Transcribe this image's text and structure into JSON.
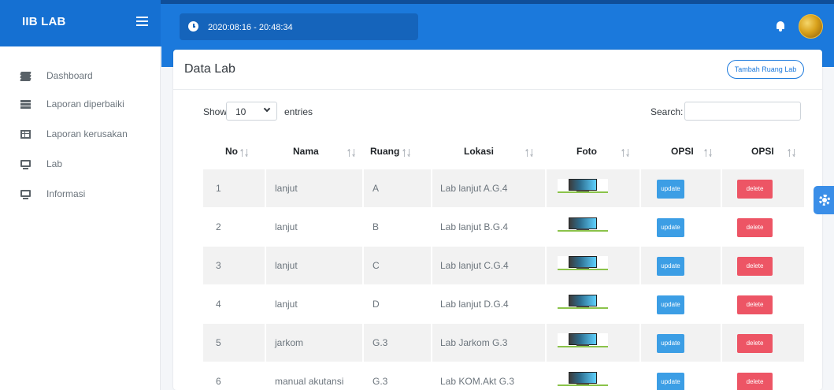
{
  "brand": {
    "name": "IIB LAB"
  },
  "header": {
    "datetime": "2020:08:16 - 20:48:34"
  },
  "sidebar": {
    "items": [
      {
        "label": "Dashboard",
        "icon": "layers-icon"
      },
      {
        "label": "Laporan diperbaiki",
        "icon": "list-icon"
      },
      {
        "label": "Laporan kerusakan",
        "icon": "table-icon"
      },
      {
        "label": "Lab",
        "icon": "monitor-icon"
      },
      {
        "label": "Informasi",
        "icon": "monitor-icon"
      }
    ]
  },
  "card": {
    "title": "Data Lab",
    "add_button": "Tambah Ruang Lab"
  },
  "controls": {
    "show_label": "Show",
    "entries_value": "10",
    "entries_label": "entries",
    "search_label": "Search:",
    "search_value": ""
  },
  "table": {
    "headers": [
      "No",
      "Nama",
      "Ruang",
      "Lokasi",
      "Foto",
      "OPSI",
      "OPSI"
    ],
    "update_label": "update",
    "delete_label": "delete",
    "rows": [
      {
        "no": "1",
        "nama": "lanjut",
        "ruang": "A",
        "lokasi": "Lab lanjut A.G.4"
      },
      {
        "no": "2",
        "nama": "lanjut",
        "ruang": "B",
        "lokasi": "Lab lanjut B.G.4"
      },
      {
        "no": "3",
        "nama": "lanjut",
        "ruang": "C",
        "lokasi": "Lab lanjut C.G.4"
      },
      {
        "no": "4",
        "nama": "lanjut",
        "ruang": "D",
        "lokasi": "Lab lanjut D.G.4"
      },
      {
        "no": "5",
        "nama": "jarkom",
        "ruang": "G.3",
        "lokasi": "Lab Jarkom G.3"
      },
      {
        "no": "6",
        "nama": "manual akutansi",
        "ruang": "G.3",
        "lokasi": "Lab KOM.Akt G.3"
      }
    ]
  },
  "colors": {
    "primary": "#1b79dc",
    "update": "#3c9ee5",
    "delete": "#ed5565"
  }
}
